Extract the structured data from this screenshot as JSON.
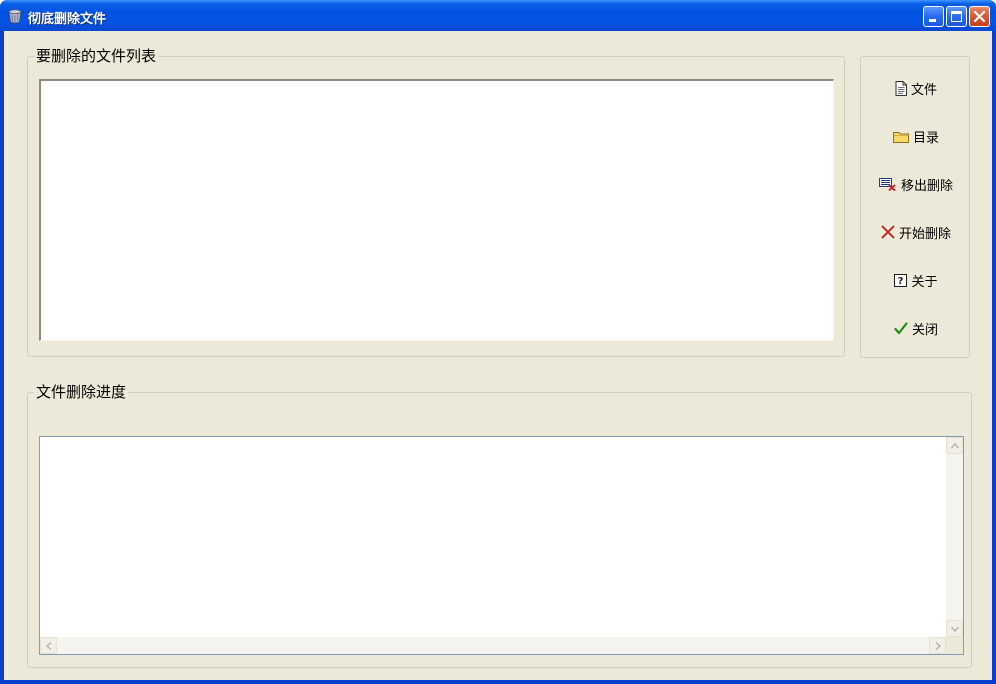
{
  "window": {
    "title": "彻底删除文件",
    "icon": "recycle-bin-icon",
    "controls": [
      "minimize-icon",
      "maximize-icon",
      "close-icon"
    ]
  },
  "file_list_group": {
    "label": "要删除的文件列表",
    "items": []
  },
  "actions": [
    {
      "label": "文件",
      "icon": "document-icon"
    },
    {
      "label": "目录",
      "icon": "folder-icon"
    },
    {
      "label": "移出删除",
      "icon": "remove-from-list-icon"
    },
    {
      "label": "开始删除",
      "icon": "red-x-icon"
    },
    {
      "label": "关于",
      "icon": "help-icon"
    },
    {
      "label": "关闭",
      "icon": "green-check-icon"
    }
  ],
  "progress_group": {
    "label": "文件删除进度",
    "rows": []
  },
  "colors": {
    "titlebar": "#0252e0",
    "dialog_bg": "#ece9d8",
    "remove_red": "#c0181a",
    "check_green": "#1e8a1e"
  }
}
